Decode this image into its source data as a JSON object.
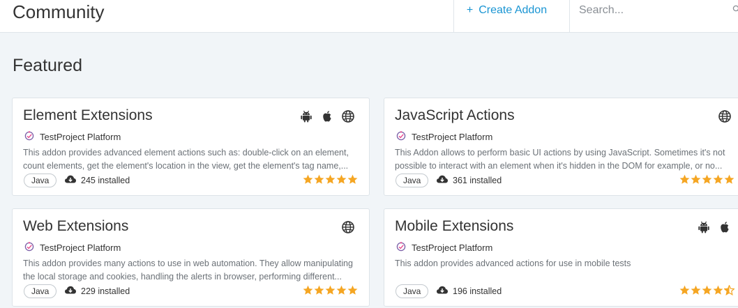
{
  "header": {
    "title": "Community",
    "create_label": "Create Addon",
    "create_icon": "plus-icon",
    "search_placeholder": "Search..."
  },
  "section_title": "Featured",
  "colors": {
    "accent": "#1a95d3",
    "star": "#f5a623",
    "icon_dark": "#333333"
  },
  "cards": [
    {
      "title": "Element Extensions",
      "platforms": [
        "android-icon",
        "apple-icon",
        "globe-icon"
      ],
      "author": "TestProject Platform",
      "desc_lines": [
        "This addon provides advanced element actions such as: double-click on an element,",
        "count elements, get the element's location in the view, get the element's tag name,..."
      ],
      "language": "Java",
      "installed": "245 installed",
      "rating": 5
    },
    {
      "title": "JavaScript Actions",
      "platforms": [
        "globe-icon"
      ],
      "author": "TestProject Platform",
      "desc_lines": [
        "This Addon allows to perform basic UI actions by using JavaScript. Sometimes it's not",
        "possible to interact with an element when it's hidden in the DOM for example, or no..."
      ],
      "language": "Java",
      "installed": "361 installed",
      "rating": 5
    },
    {
      "title": "Web Extensions",
      "platforms": [
        "globe-icon"
      ],
      "author": "TestProject Platform",
      "desc_lines": [
        "This addon provides many actions to use in web automation. They allow manipulating",
        "the local storage and cookies, handling the alerts in browser, performing different..."
      ],
      "language": "Java",
      "installed": "229 installed",
      "rating": 5
    },
    {
      "title": "Mobile Extensions",
      "platforms": [
        "android-icon",
        "apple-icon"
      ],
      "author": "TestProject Platform",
      "desc_lines": [
        "This addon provides advanced actions for use in mobile tests"
      ],
      "language": "Java",
      "installed": "196 installed",
      "rating": 4.5
    }
  ]
}
